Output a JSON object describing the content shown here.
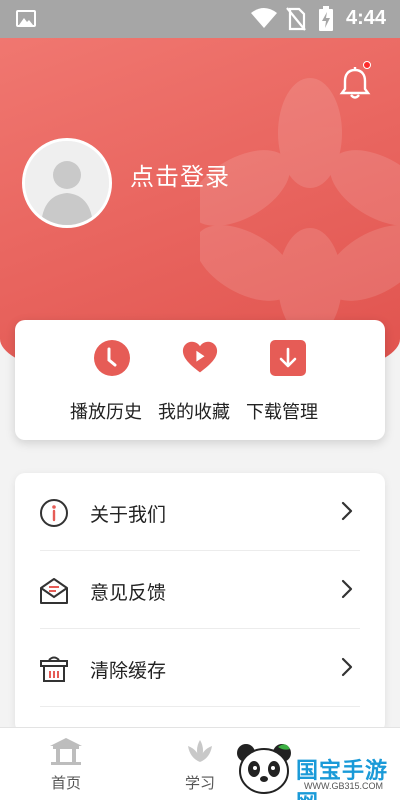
{
  "status_bar": {
    "time": "4:44"
  },
  "header": {
    "login_text": "点击登录"
  },
  "quick_actions": [
    {
      "label": "播放历史",
      "icon": "clock-icon"
    },
    {
      "label": "我的收藏",
      "icon": "heart-play-icon"
    },
    {
      "label": "下载管理",
      "icon": "download-icon"
    }
  ],
  "menu": [
    {
      "label": "关于我们",
      "icon": "info-icon"
    },
    {
      "label": "意见反馈",
      "icon": "feedback-mail-icon"
    },
    {
      "label": "清除缓存",
      "icon": "trash-basket-icon"
    }
  ],
  "tabs": [
    {
      "label": "首页",
      "icon": "home-temple-icon"
    },
    {
      "label": "学习",
      "icon": "lotus-icon"
    }
  ],
  "watermark": {
    "brand": "国宝手游网",
    "url": "WWW.GB315.COM"
  },
  "colors": {
    "accent": "#e96660",
    "icon_red": "#e65c56"
  }
}
